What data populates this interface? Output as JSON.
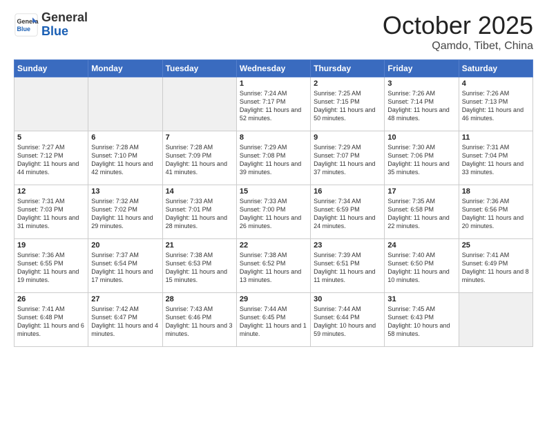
{
  "header": {
    "logo_general": "General",
    "logo_blue": "Blue",
    "month": "October 2025",
    "location": "Qamdo, Tibet, China"
  },
  "days_of_week": [
    "Sunday",
    "Monday",
    "Tuesday",
    "Wednesday",
    "Thursday",
    "Friday",
    "Saturday"
  ],
  "weeks": [
    [
      {
        "day": "",
        "empty": true
      },
      {
        "day": "",
        "empty": true
      },
      {
        "day": "",
        "empty": true
      },
      {
        "day": "1",
        "sunrise": "7:24 AM",
        "sunset": "7:17 PM",
        "daylight": "11 hours and 52 minutes."
      },
      {
        "day": "2",
        "sunrise": "7:25 AM",
        "sunset": "7:15 PM",
        "daylight": "11 hours and 50 minutes."
      },
      {
        "day": "3",
        "sunrise": "7:26 AM",
        "sunset": "7:14 PM",
        "daylight": "11 hours and 48 minutes."
      },
      {
        "day": "4",
        "sunrise": "7:26 AM",
        "sunset": "7:13 PM",
        "daylight": "11 hours and 46 minutes."
      }
    ],
    [
      {
        "day": "5",
        "sunrise": "7:27 AM",
        "sunset": "7:12 PM",
        "daylight": "11 hours and 44 minutes."
      },
      {
        "day": "6",
        "sunrise": "7:28 AM",
        "sunset": "7:10 PM",
        "daylight": "11 hours and 42 minutes."
      },
      {
        "day": "7",
        "sunrise": "7:28 AM",
        "sunset": "7:09 PM",
        "daylight": "11 hours and 41 minutes."
      },
      {
        "day": "8",
        "sunrise": "7:29 AM",
        "sunset": "7:08 PM",
        "daylight": "11 hours and 39 minutes."
      },
      {
        "day": "9",
        "sunrise": "7:29 AM",
        "sunset": "7:07 PM",
        "daylight": "11 hours and 37 minutes."
      },
      {
        "day": "10",
        "sunrise": "7:30 AM",
        "sunset": "7:06 PM",
        "daylight": "11 hours and 35 minutes."
      },
      {
        "day": "11",
        "sunrise": "7:31 AM",
        "sunset": "7:04 PM",
        "daylight": "11 hours and 33 minutes."
      }
    ],
    [
      {
        "day": "12",
        "sunrise": "7:31 AM",
        "sunset": "7:03 PM",
        "daylight": "11 hours and 31 minutes."
      },
      {
        "day": "13",
        "sunrise": "7:32 AM",
        "sunset": "7:02 PM",
        "daylight": "11 hours and 29 minutes."
      },
      {
        "day": "14",
        "sunrise": "7:33 AM",
        "sunset": "7:01 PM",
        "daylight": "11 hours and 28 minutes."
      },
      {
        "day": "15",
        "sunrise": "7:33 AM",
        "sunset": "7:00 PM",
        "daylight": "11 hours and 26 minutes."
      },
      {
        "day": "16",
        "sunrise": "7:34 AM",
        "sunset": "6:59 PM",
        "daylight": "11 hours and 24 minutes."
      },
      {
        "day": "17",
        "sunrise": "7:35 AM",
        "sunset": "6:58 PM",
        "daylight": "11 hours and 22 minutes."
      },
      {
        "day": "18",
        "sunrise": "7:36 AM",
        "sunset": "6:56 PM",
        "daylight": "11 hours and 20 minutes."
      }
    ],
    [
      {
        "day": "19",
        "sunrise": "7:36 AM",
        "sunset": "6:55 PM",
        "daylight": "11 hours and 19 minutes."
      },
      {
        "day": "20",
        "sunrise": "7:37 AM",
        "sunset": "6:54 PM",
        "daylight": "11 hours and 17 minutes."
      },
      {
        "day": "21",
        "sunrise": "7:38 AM",
        "sunset": "6:53 PM",
        "daylight": "11 hours and 15 minutes."
      },
      {
        "day": "22",
        "sunrise": "7:38 AM",
        "sunset": "6:52 PM",
        "daylight": "11 hours and 13 minutes."
      },
      {
        "day": "23",
        "sunrise": "7:39 AM",
        "sunset": "6:51 PM",
        "daylight": "11 hours and 11 minutes."
      },
      {
        "day": "24",
        "sunrise": "7:40 AM",
        "sunset": "6:50 PM",
        "daylight": "11 hours and 10 minutes."
      },
      {
        "day": "25",
        "sunrise": "7:41 AM",
        "sunset": "6:49 PM",
        "daylight": "11 hours and 8 minutes."
      }
    ],
    [
      {
        "day": "26",
        "sunrise": "7:41 AM",
        "sunset": "6:48 PM",
        "daylight": "11 hours and 6 minutes."
      },
      {
        "day": "27",
        "sunrise": "7:42 AM",
        "sunset": "6:47 PM",
        "daylight": "11 hours and 4 minutes."
      },
      {
        "day": "28",
        "sunrise": "7:43 AM",
        "sunset": "6:46 PM",
        "daylight": "11 hours and 3 minutes."
      },
      {
        "day": "29",
        "sunrise": "7:44 AM",
        "sunset": "6:45 PM",
        "daylight": "11 hours and 1 minute."
      },
      {
        "day": "30",
        "sunrise": "7:44 AM",
        "sunset": "6:44 PM",
        "daylight": "10 hours and 59 minutes."
      },
      {
        "day": "31",
        "sunrise": "7:45 AM",
        "sunset": "6:43 PM",
        "daylight": "10 hours and 58 minutes."
      },
      {
        "day": "",
        "empty": true
      }
    ]
  ]
}
